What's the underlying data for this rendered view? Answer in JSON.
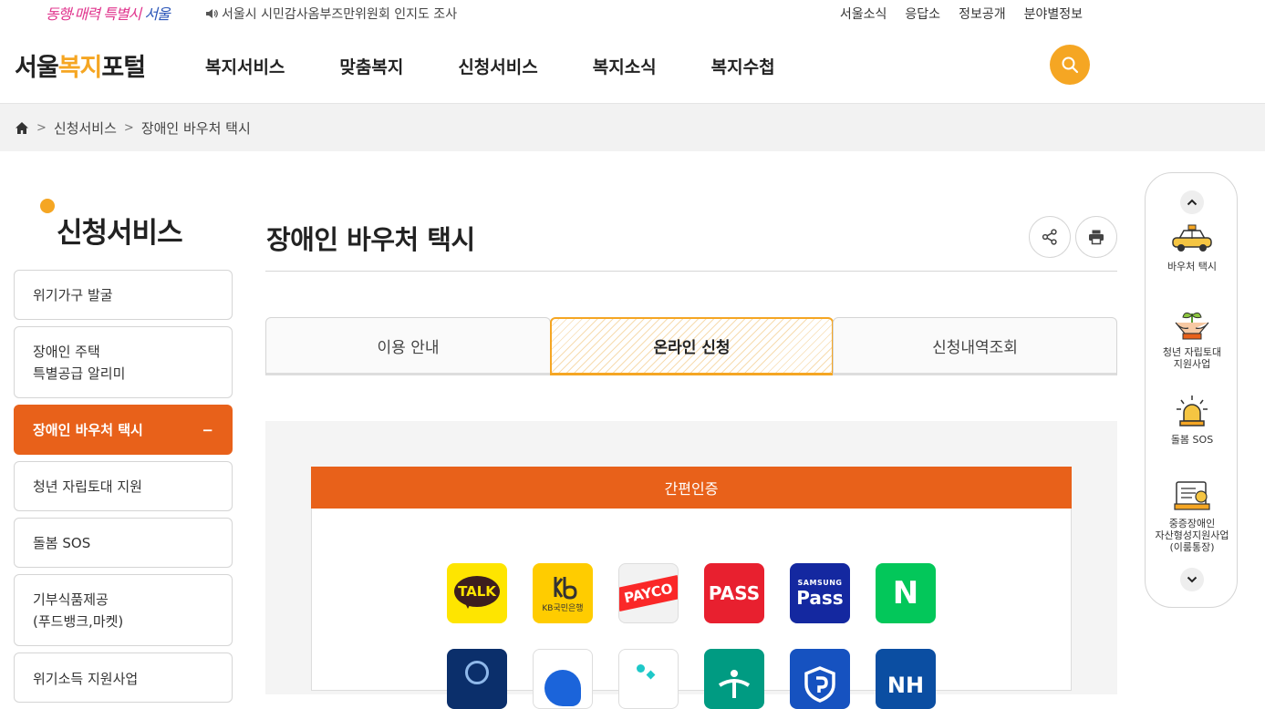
{
  "util": {
    "slogan_pink": "동행·매력 특별시",
    "slogan_blue": "서울",
    "notice": "서울시 시민감사옴부즈만위원회 인지도 조사",
    "links": [
      "서울소식",
      "응답소",
      "정보공개",
      "분야별정보"
    ]
  },
  "header": {
    "logo_a": "서울",
    "logo_b": "복지",
    "logo_c": "포털",
    "gnb": [
      "복지서비스",
      "맞춤복지",
      "신청서비스",
      "복지소식",
      "복지수첩"
    ]
  },
  "breadcrumb": {
    "level1": "신청서비스",
    "level2": "장애인 바우처 택시"
  },
  "sidebar": {
    "title": "신청서비스",
    "items": [
      {
        "label": "위기가구 발굴"
      },
      {
        "line1": "장애인 주택",
        "line2": "특별공급 알리미"
      },
      {
        "label": "장애인 바우처 택시",
        "toggle": "−"
      },
      {
        "label": "청년 자립토대 지원"
      },
      {
        "label": "돌봄 SOS"
      },
      {
        "line1": "기부식품제공",
        "line2": "(푸드뱅크,마켓)"
      },
      {
        "label": "위기소득 지원사업"
      }
    ]
  },
  "main": {
    "title": "장애인 바우처 택시",
    "tabs": [
      "이용 안내",
      "온라인 신청",
      "신청내역조회"
    ],
    "auth_title": "간편인증",
    "apps": {
      "kakao": "TALK",
      "kb": "KB국민은행",
      "payco": "PAYCO",
      "pass": "PASS",
      "samsung_small": "SAMSUNG",
      "samsung_big": "Pass",
      "naver": "N",
      "nh": "NH"
    }
  },
  "quick": {
    "items": [
      {
        "line1": "바우처 택시"
      },
      {
        "line1": "청년 자립토대",
        "line2": "지원사업"
      },
      {
        "line1": "돌봄 SOS"
      },
      {
        "line1": "중증장애인",
        "line2": "자산형성지원사업",
        "line3": "(이룸통장)"
      }
    ]
  }
}
